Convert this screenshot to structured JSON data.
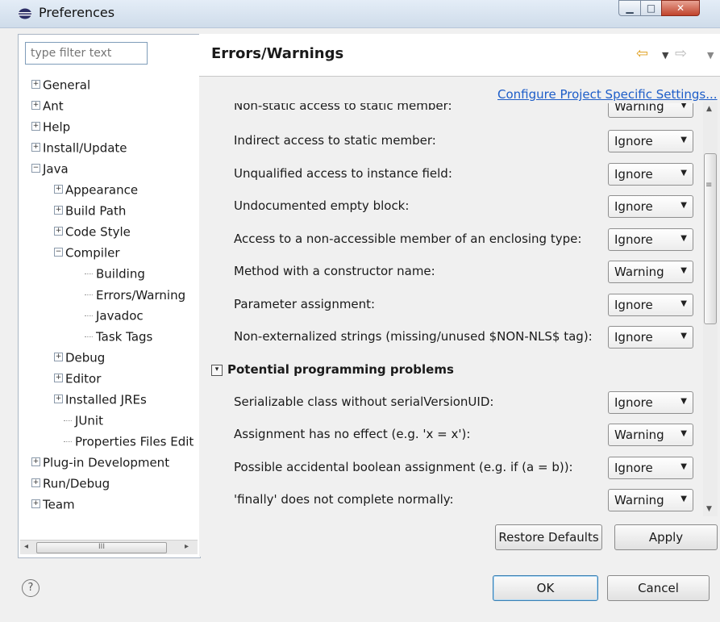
{
  "window": {
    "title": "Preferences",
    "controls": {
      "minimize": "▁",
      "maximize": "□",
      "close": "✕"
    }
  },
  "left": {
    "filter_placeholder": "type filter text",
    "tree": [
      {
        "label": "General",
        "toggle": "+"
      },
      {
        "label": "Ant",
        "toggle": "+"
      },
      {
        "label": "Help",
        "toggle": "+"
      },
      {
        "label": "Install/Update",
        "toggle": "+"
      },
      {
        "label": "Java",
        "toggle": "−"
      },
      {
        "label": "Appearance",
        "toggle": "+"
      },
      {
        "label": "Build Path",
        "toggle": "+"
      },
      {
        "label": "Code Style",
        "toggle": "+"
      },
      {
        "label": "Compiler",
        "toggle": "−"
      },
      {
        "label": "Building"
      },
      {
        "label": "Errors/Warning"
      },
      {
        "label": "Javadoc"
      },
      {
        "label": "Task Tags"
      },
      {
        "label": "Debug",
        "toggle": "+"
      },
      {
        "label": "Editor",
        "toggle": "+"
      },
      {
        "label": "Installed JREs",
        "toggle": "+"
      },
      {
        "label": "JUnit"
      },
      {
        "label": "Properties Files Edit"
      },
      {
        "label": "Plug-in Development",
        "toggle": "+"
      },
      {
        "label": "Run/Debug",
        "toggle": "+"
      },
      {
        "label": "Team",
        "toggle": "+"
      }
    ],
    "hscroll": {
      "left": "◂",
      "grip": "III",
      "right": "▸"
    }
  },
  "right": {
    "title": "Errors/Warnings",
    "nav": {
      "back": "⇦",
      "back_dd": "▼",
      "fwd": "⇨",
      "fwd_dd": "▼"
    },
    "config_link": "Configure Project Specific Settings...",
    "rows": [
      {
        "label": "Non-static access to static member:",
        "value": "Warning"
      },
      {
        "label": "Indirect access to static member:",
        "value": "Ignore"
      },
      {
        "label": "Unqualified access to instance field:",
        "value": "Ignore"
      },
      {
        "label": "Undocumented empty block:",
        "value": "Ignore"
      },
      {
        "label": "Access to a non-accessible member of an enclosing type:",
        "value": "Ignore"
      },
      {
        "label": "Method with a constructor name:",
        "value": "Warning"
      },
      {
        "label": "Parameter assignment:",
        "value": "Ignore"
      },
      {
        "label": "Non-externalized strings (missing/unused $NON-NLS$ tag):",
        "value": "Ignore"
      }
    ],
    "section": {
      "toggle": "▾",
      "title": "Potential programming problems"
    },
    "section_rows": [
      {
        "label": "Serializable class without serialVersionUID:",
        "value": "Ignore"
      },
      {
        "label": "Assignment has no effect (e.g. 'x = x'):",
        "value": "Warning"
      },
      {
        "label": "Possible accidental boolean assignment (e.g. if (a = b)):",
        "value": "Ignore"
      },
      {
        "label": "'finally' does not complete normally:",
        "value": "Warning"
      }
    ],
    "vscroll": {
      "up": "▲",
      "down": "▼",
      "grip": "≡"
    },
    "restore_label": "Restore Defaults",
    "apply_label": "Apply"
  },
  "footer": {
    "help": "?",
    "ok_label": "OK",
    "cancel_label": "Cancel"
  }
}
